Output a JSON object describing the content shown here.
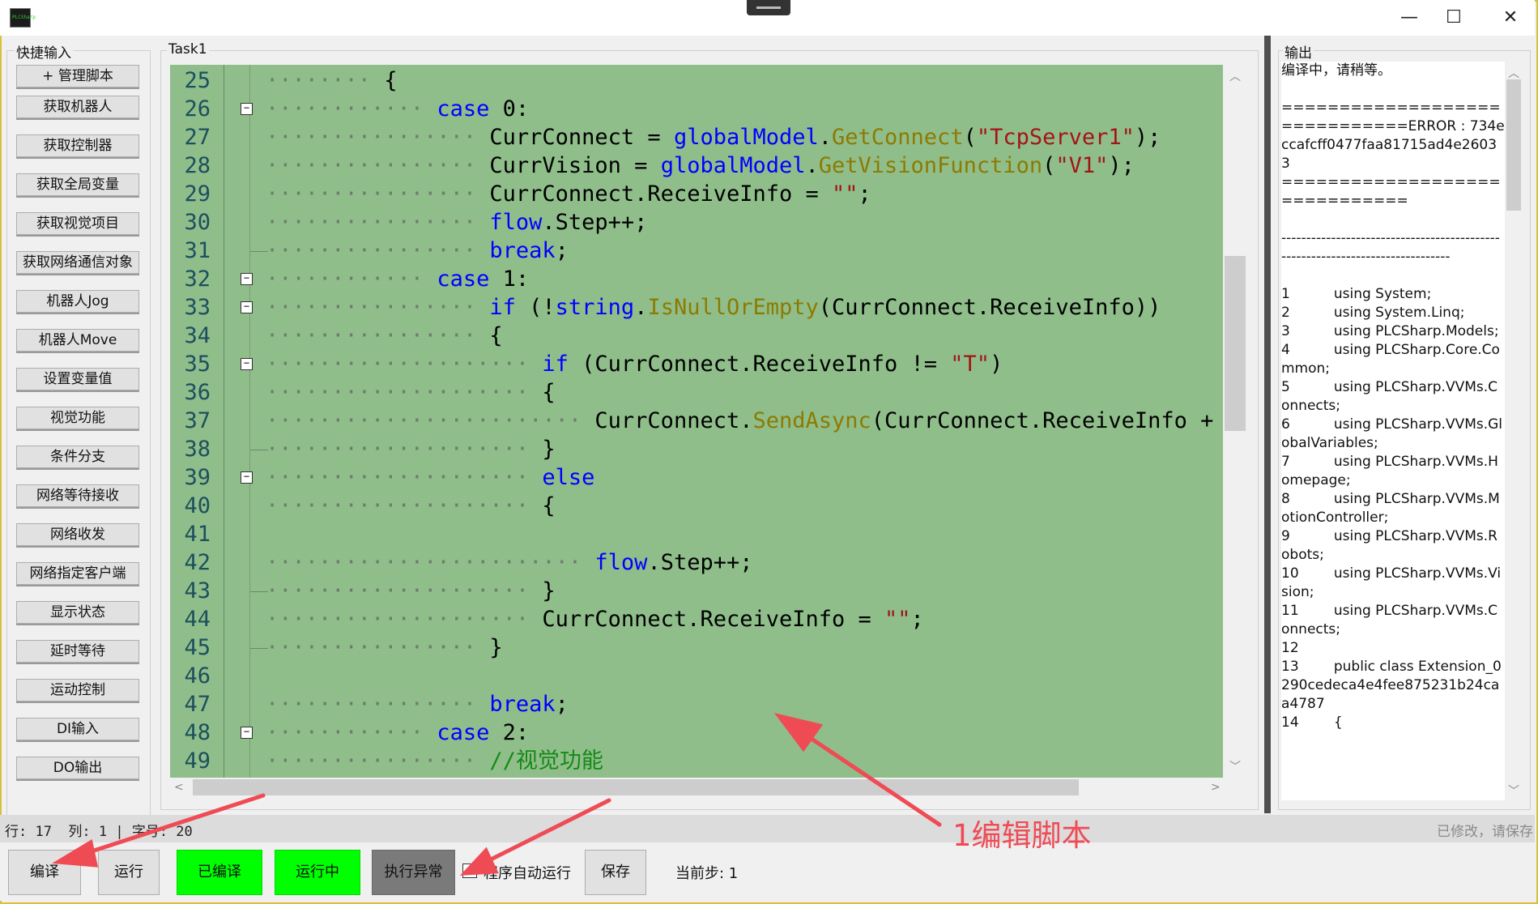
{
  "window": {
    "icon_text": "PLCSharp",
    "minimize": "—",
    "maximize": "☐",
    "close": "✕"
  },
  "quick": {
    "title": "快捷输入",
    "buttons": [
      "+ 管理脚本",
      "获取机器人",
      "获取控制器",
      "获取全局变量",
      "获取视觉项目",
      "获取网络通信对象",
      "机器人Jog",
      "机器人Move",
      "设置变量值",
      "视觉功能",
      "条件分支",
      "网络等待接收",
      "网络收发",
      "网络指定客户端",
      "显示状态",
      "延时等待",
      "运动控制",
      "DI输入",
      "DO输出"
    ]
  },
  "editor": {
    "title": "Task1",
    "lines": [
      {
        "n": "25",
        "ind": 4,
        "fold": false,
        "end": false,
        "tokens": [
          {
            "t": "{",
            "c": ""
          }
        ]
      },
      {
        "n": "26",
        "ind": 6,
        "fold": true,
        "end": false,
        "tokens": [
          {
            "t": "case",
            "c": "kw"
          },
          {
            "t": " 0:",
            "c": ""
          }
        ]
      },
      {
        "n": "27",
        "ind": 8,
        "fold": false,
        "end": false,
        "tokens": [
          {
            "t": "CurrConnect = ",
            "c": ""
          },
          {
            "t": "globalModel",
            "c": "kw"
          },
          {
            "t": ".",
            "c": ""
          },
          {
            "t": "GetConnect",
            "c": "fn"
          },
          {
            "t": "(",
            "c": ""
          },
          {
            "t": "\"TcpServer1\"",
            "c": "str"
          },
          {
            "t": ");",
            "c": ""
          }
        ]
      },
      {
        "n": "28",
        "ind": 8,
        "fold": false,
        "end": false,
        "tokens": [
          {
            "t": "CurrVision = ",
            "c": ""
          },
          {
            "t": "globalModel",
            "c": "kw"
          },
          {
            "t": ".",
            "c": ""
          },
          {
            "t": "GetVisionFunction",
            "c": "fn"
          },
          {
            "t": "(",
            "c": ""
          },
          {
            "t": "\"V1\"",
            "c": "str"
          },
          {
            "t": ");",
            "c": ""
          }
        ]
      },
      {
        "n": "29",
        "ind": 8,
        "fold": false,
        "end": false,
        "tokens": [
          {
            "t": "CurrConnect.ReceiveInfo = ",
            "c": ""
          },
          {
            "t": "\"\"",
            "c": "str"
          },
          {
            "t": ";",
            "c": ""
          }
        ]
      },
      {
        "n": "30",
        "ind": 8,
        "fold": false,
        "end": false,
        "tokens": [
          {
            "t": "flow",
            "c": "kw"
          },
          {
            "t": ".Step++;",
            "c": ""
          }
        ]
      },
      {
        "n": "31",
        "ind": 8,
        "fold": false,
        "end": true,
        "tokens": [
          {
            "t": "break",
            "c": "kw"
          },
          {
            "t": ";",
            "c": ""
          }
        ]
      },
      {
        "n": "32",
        "ind": 6,
        "fold": true,
        "end": false,
        "tokens": [
          {
            "t": "case",
            "c": "kw"
          },
          {
            "t": " 1:",
            "c": ""
          }
        ]
      },
      {
        "n": "33",
        "ind": 8,
        "fold": true,
        "end": false,
        "tokens": [
          {
            "t": "if",
            "c": "kw"
          },
          {
            "t": " (!",
            "c": ""
          },
          {
            "t": "string",
            "c": "kw"
          },
          {
            "t": ".",
            "c": ""
          },
          {
            "t": "IsNullOrEmpty",
            "c": "fn"
          },
          {
            "t": "(CurrConnect.ReceiveInfo))",
            "c": ""
          }
        ]
      },
      {
        "n": "34",
        "ind": 8,
        "fold": false,
        "end": false,
        "tokens": [
          {
            "t": "{",
            "c": ""
          }
        ]
      },
      {
        "n": "35",
        "ind": 10,
        "fold": true,
        "end": false,
        "tokens": [
          {
            "t": "if",
            "c": "kw"
          },
          {
            "t": " (CurrConnect.ReceiveInfo != ",
            "c": ""
          },
          {
            "t": "\"T\"",
            "c": "str"
          },
          {
            "t": ")",
            "c": ""
          }
        ]
      },
      {
        "n": "36",
        "ind": 10,
        "fold": false,
        "end": false,
        "tokens": [
          {
            "t": "{",
            "c": ""
          }
        ]
      },
      {
        "n": "37",
        "ind": 12,
        "fold": false,
        "end": false,
        "tokens": [
          {
            "t": "CurrConnect.",
            "c": ""
          },
          {
            "t": "SendAsync",
            "c": "fn"
          },
          {
            "t": "(CurrConnect.ReceiveInfo +",
            "c": ""
          }
        ]
      },
      {
        "n": "38",
        "ind": 10,
        "fold": false,
        "end": true,
        "tokens": [
          {
            "t": "}",
            "c": ""
          }
        ]
      },
      {
        "n": "39",
        "ind": 10,
        "fold": true,
        "end": false,
        "tokens": [
          {
            "t": "else",
            "c": "kw"
          }
        ]
      },
      {
        "n": "40",
        "ind": 10,
        "fold": false,
        "end": false,
        "tokens": [
          {
            "t": "{",
            "c": ""
          }
        ]
      },
      {
        "n": "41",
        "ind": 0,
        "fold": false,
        "end": false,
        "tokens": []
      },
      {
        "n": "42",
        "ind": 12,
        "fold": false,
        "end": false,
        "tokens": [
          {
            "t": "flow",
            "c": "kw"
          },
          {
            "t": ".Step++;",
            "c": ""
          }
        ]
      },
      {
        "n": "43",
        "ind": 10,
        "fold": false,
        "end": true,
        "tokens": [
          {
            "t": "}",
            "c": ""
          }
        ]
      },
      {
        "n": "44",
        "ind": 10,
        "fold": false,
        "end": false,
        "tokens": [
          {
            "t": "CurrConnect.ReceiveInfo = ",
            "c": ""
          },
          {
            "t": "\"\"",
            "c": "str"
          },
          {
            "t": ";",
            "c": ""
          }
        ]
      },
      {
        "n": "45",
        "ind": 8,
        "fold": false,
        "end": true,
        "tokens": [
          {
            "t": "}",
            "c": ""
          }
        ]
      },
      {
        "n": "46",
        "ind": 0,
        "fold": false,
        "end": false,
        "tokens": []
      },
      {
        "n": "47",
        "ind": 8,
        "fold": false,
        "end": false,
        "tokens": [
          {
            "t": "break",
            "c": "kw"
          },
          {
            "t": ";",
            "c": ""
          }
        ]
      },
      {
        "n": "48",
        "ind": 6,
        "fold": true,
        "end": false,
        "tokens": [
          {
            "t": "case",
            "c": "kw"
          },
          {
            "t": " 2:",
            "c": ""
          }
        ]
      },
      {
        "n": "49",
        "ind": 8,
        "fold": false,
        "end": false,
        "tokens": [
          {
            "t": "//视觉功能",
            "c": "cm"
          }
        ]
      }
    ]
  },
  "output": {
    "title": "输出",
    "lines": [
      "编译中，请稍等。",
      "",
      "==============================ERROR : 734eccafcff0477faa81715ad4e26033",
      "==============================",
      "",
      "------------------------------------------------------------------------------",
      "",
      "1          using System;",
      "2          using System.Linq;",
      "3          using PLCSharp.Models;",
      "4          using PLCSharp.Core.Common;",
      "5          using PLCSharp.VVMs.Connects;",
      "6          using PLCSharp.VVMs.GlobalVariables;",
      "7          using PLCSharp.VVMs.Homepage;",
      "8          using PLCSharp.VVMs.MotionController;",
      "9          using PLCSharp.VVMs.Robots;",
      "10        using PLCSharp.VVMs.Vision;",
      "11        using PLCSharp.VVMs.Connects;",
      "12",
      "13        public class Extension_0290cedeca4e4fee875231b24caa4787",
      "14        {"
    ]
  },
  "status": {
    "position": "行: 17  列: 1 | 字号: 20",
    "modified": "已修改，请保存"
  },
  "bottom": {
    "compile": "编译",
    "run": "运行",
    "compiled": "已编译",
    "running": "运行中",
    "exec_error": "执行异常",
    "auto_run_label": "程序自动运行",
    "auto_run_checked": "✓",
    "save": "保存",
    "current_step": "当前步: 1"
  },
  "annotation": {
    "text": "1编辑脚本",
    "color": "#ef4b55"
  }
}
